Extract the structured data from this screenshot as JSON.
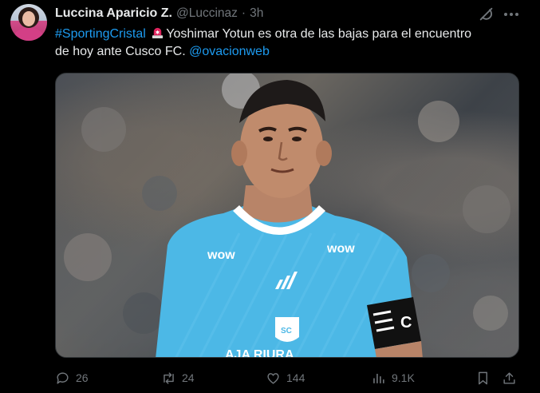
{
  "tweet": {
    "display_name": "Luccina Aparicio Z.",
    "handle": "@Luccinaz",
    "separator": "·",
    "time": "3h",
    "text": {
      "hashtag": "#SportingCristal",
      "siren_icon": "police-light-emoji",
      "line1_rest": "Yoshimar Yotun es otra de las bajas para el encuentro",
      "line2": "de hoy ante Cusco FC.",
      "mention": "@ovacionweb"
    },
    "media": {
      "jersey_sponsor": "wow",
      "armband_text": "C",
      "crest_text": "SC",
      "bottom_sponsor": "AJA RIURA"
    },
    "actions": {
      "replies": "26",
      "reposts": "24",
      "likes": "144",
      "views": "9.1K"
    },
    "icons": [
      "grok-icon",
      "more-icon",
      "reply-icon",
      "repost-icon",
      "like-icon",
      "views-icon",
      "bookmark-icon",
      "share-icon"
    ]
  },
  "colors": {
    "background": "#000000",
    "text": "#e7e9ea",
    "muted": "#71767b",
    "link": "#1d9bf0",
    "jersey": "#4cb8e6"
  }
}
